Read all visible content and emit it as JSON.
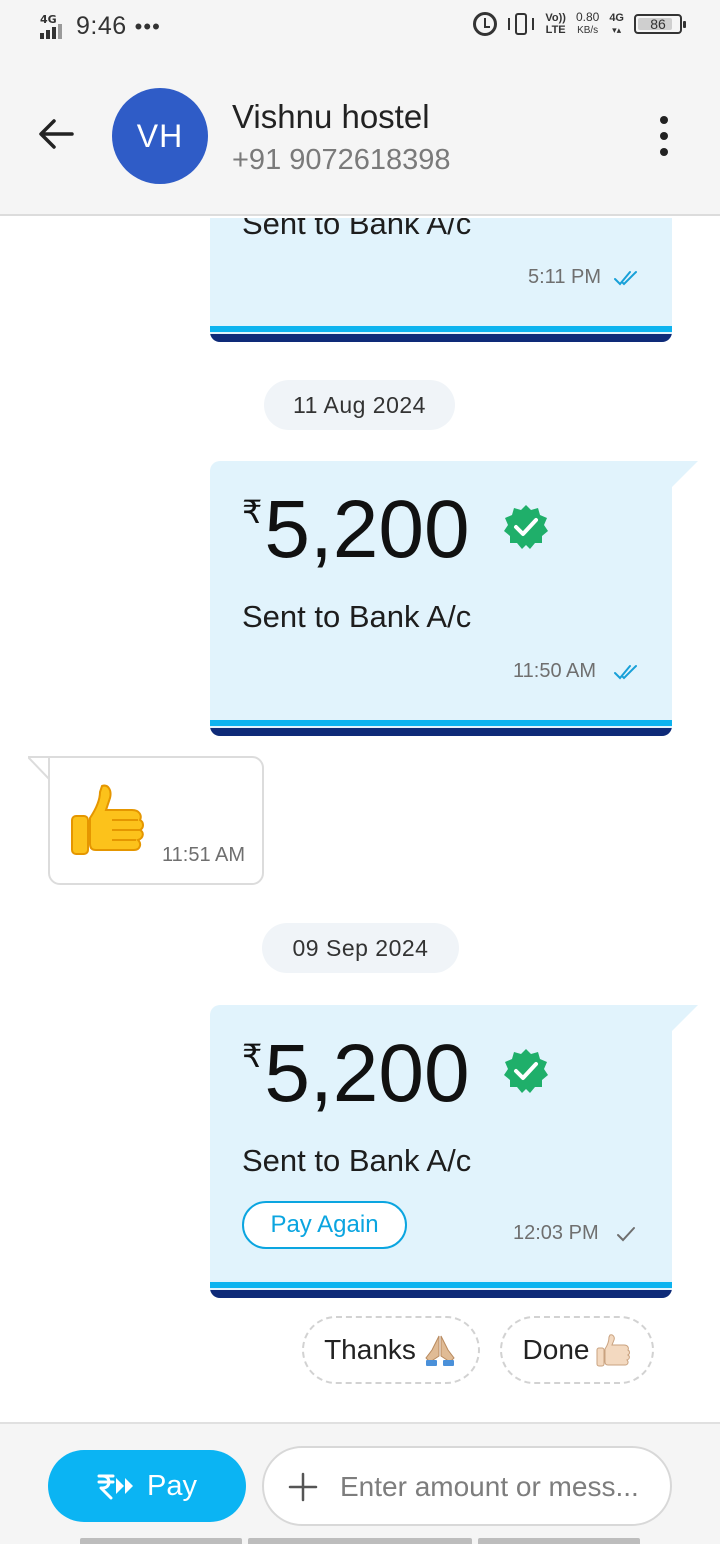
{
  "status_bar": {
    "signal_label": "4G",
    "time": "9:46",
    "dots": "•••",
    "volte_top": "Vo))",
    "volte_bottom": "LTE",
    "speed_value": "0.80",
    "speed_unit": "KB/s",
    "net_label": "4G",
    "battery": "86",
    "battery_level": 0.86
  },
  "header": {
    "avatar_initials": "VH",
    "contact_name": "Vishnu hostel",
    "contact_phone": "+91 9072618398"
  },
  "messages": {
    "top_card": {
      "sent_text": "Sent to Bank A/c",
      "time": "5:11 PM"
    },
    "date_1": "11 Aug 2024",
    "card_1": {
      "currency": "₹",
      "amount": "5,200",
      "sent_text": "Sent to Bank A/c",
      "time": "11:50 AM"
    },
    "received": {
      "emoji": "thumbs-up",
      "time": "11:51 AM"
    },
    "date_2": "09 Sep 2024",
    "card_2": {
      "currency": "₹",
      "amount": "5,200",
      "sent_text": "Sent to Bank A/c",
      "pay_again_label": "Pay Again",
      "time": "12:03 PM"
    }
  },
  "quick_replies": [
    {
      "label": "Thanks",
      "emoji": "folded-hands"
    },
    {
      "label": "Done",
      "emoji": "thumbs-up-light"
    }
  ],
  "bottom_bar": {
    "pay_label": "Pay",
    "input_placeholder": "Enter amount or mess..."
  },
  "colors": {
    "accent": "#0BB4F3",
    "card_bg": "#E1F3FC",
    "card_stripe_dark": "#0E2A78",
    "avatar": "#2F5CC7",
    "verified": "#1FAF6A"
  }
}
